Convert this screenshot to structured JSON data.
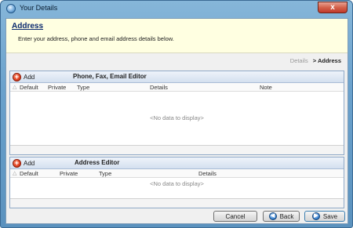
{
  "window": {
    "title": "Your Details",
    "close_label": "x"
  },
  "header": {
    "title": "Address",
    "description": "Enter your address, phone and email address details below."
  },
  "breadcrumb": {
    "inactive": "Details",
    "active": "> Address"
  },
  "phone_panel": {
    "add_label": "Add",
    "title": "Phone, Fax, Email Editor",
    "columns": [
      "Default",
      "Private",
      "Type",
      "Details",
      "Note"
    ],
    "empty_text": "<No data to display>"
  },
  "address_panel": {
    "add_label": "Add",
    "title": "Address Editor",
    "columns": [
      "Default",
      "Private",
      "Type",
      "Details"
    ],
    "empty_text": "<No data to display>"
  },
  "buttons": {
    "cancel": "Cancel",
    "back": "Back",
    "save": "Save"
  },
  "colors": {
    "accent": "#0b2a6e",
    "header_bg": "#ffffe1",
    "panel_border": "#8fa9c7"
  }
}
